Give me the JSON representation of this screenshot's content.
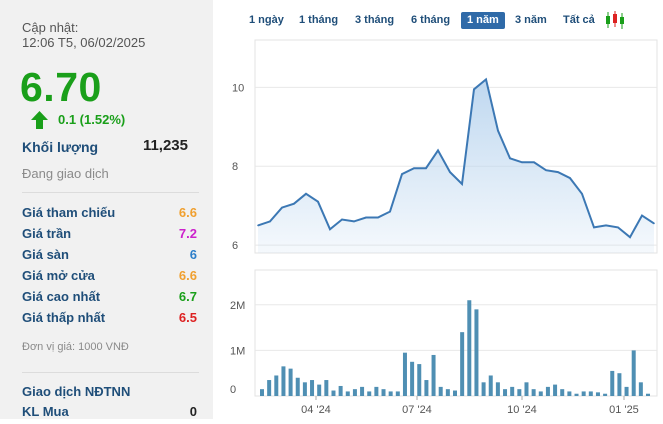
{
  "info": {
    "updated_label": "Cập nhật:",
    "updated_time": "12:06 T5, 06/02/2025",
    "price": "6.70",
    "change": "0.1 (1.52%)",
    "volume_label": "Khối lượng",
    "volume": "11,235",
    "status": "Đang giao dịch",
    "unit": "Đơn vị giá: 1000 VNĐ",
    "foreign_title": "Giao dịch NĐTNN",
    "buy_label": "KL Mua",
    "buy_value": "0"
  },
  "prices": [
    {
      "label": "Giá tham chiếu",
      "value": "6.6",
      "color": "#f0a030"
    },
    {
      "label": "Giá trần",
      "value": "7.2",
      "color": "#cc22cc"
    },
    {
      "label": "Giá sàn",
      "value": "6",
      "color": "#2e7fc9"
    },
    {
      "label": "Giá mở cửa",
      "value": "6.6",
      "color": "#f0a030"
    },
    {
      "label": "Giá cao nhất",
      "value": "6.7",
      "color": "#1a9f1a"
    },
    {
      "label": "Giá thấp nhất",
      "value": "6.5",
      "color": "#dd2222"
    }
  ],
  "tabs": [
    "1 ngày",
    "1 tháng",
    "3 tháng",
    "6 tháng",
    "1 năm",
    "3 năm",
    "Tất cả"
  ],
  "active_tab": "1 năm",
  "colors": {
    "up": "#1a9f1a",
    "line": "#3c78b4",
    "area": "#bcd6ef",
    "bar": "#4f8fb3"
  },
  "chart_data": [
    {
      "type": "area",
      "x": [
        "2024-02",
        "2024-03",
        "2024-03",
        "2024-03",
        "2024-04",
        "2024-04",
        "2024-05",
        "2024-05",
        "2024-05",
        "2024-06",
        "2024-06",
        "2024-06",
        "2024-07",
        "2024-07",
        "2024-07",
        "2024-08",
        "2024-08",
        "2024-08",
        "2024-08",
        "2024-09",
        "2024-09",
        "2024-09",
        "2024-10",
        "2024-10",
        "2024-10",
        "2024-11",
        "2024-11",
        "2024-11",
        "2024-12",
        "2024-12",
        "2025-01",
        "2025-01",
        "2025-01",
        "2025-02"
      ],
      "values": [
        6.5,
        6.6,
        6.95,
        7.05,
        7.3,
        7.1,
        6.4,
        6.65,
        6.6,
        6.7,
        6.7,
        6.85,
        7.8,
        7.95,
        7.95,
        8.4,
        7.85,
        7.55,
        9.95,
        10.2,
        8.9,
        8.2,
        8.1,
        8.1,
        7.9,
        7.85,
        7.7,
        7.3,
        6.45,
        6.5,
        6.45,
        6.2,
        6.75,
        6.55
      ],
      "yticks": [
        "10",
        "8",
        "6"
      ],
      "ylim": [
        5.8,
        11.2
      ],
      "grid": true
    },
    {
      "type": "bar",
      "values": [
        0.15,
        0.35,
        0.45,
        0.65,
        0.6,
        0.4,
        0.3,
        0.35,
        0.25,
        0.35,
        0.12,
        0.22,
        0.1,
        0.15,
        0.2,
        0.1,
        0.2,
        0.15,
        0.1,
        0.1,
        0.95,
        0.75,
        0.7,
        0.35,
        0.9,
        0.2,
        0.15,
        0.12,
        1.4,
        2.1,
        1.9,
        0.3,
        0.45,
        0.3,
        0.15,
        0.2,
        0.15,
        0.3,
        0.15,
        0.1,
        0.2,
        0.25,
        0.15,
        0.1,
        0.05,
        0.1,
        0.1,
        0.08,
        0.05,
        0.55,
        0.5,
        0.2,
        1.0,
        0.3,
        0.05
      ],
      "yticks": [
        "2M",
        "1M",
        "0"
      ],
      "ylim": [
        0,
        2.5
      ],
      "xticks": [
        "04 '24",
        "07 '24",
        "10 '24",
        "01 '25"
      ]
    }
  ]
}
